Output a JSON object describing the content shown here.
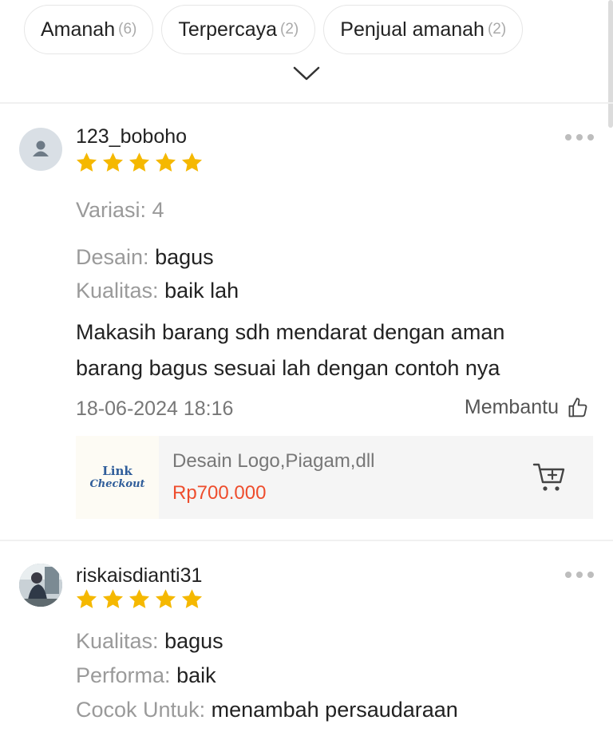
{
  "filters": [
    {
      "label": "Amanah",
      "count": "(6)"
    },
    {
      "label": "Terpercaya",
      "count": "(2)"
    },
    {
      "label": "Penjual amanah",
      "count": "(2)"
    }
  ],
  "icons": {
    "expand": "chevron-down-icon",
    "more": "more-icon",
    "helpful": "thumbs-up-icon",
    "cart": "add-to-cart-icon",
    "avatar_default": "user-icon"
  },
  "colors": {
    "star": "#f5b800",
    "price": "#ee4d2d",
    "label_gray": "#9a9a9a"
  },
  "reviews": [
    {
      "username": "123_boboho",
      "rating": 5,
      "variation": "Variasi: 4",
      "attributes": [
        {
          "label": "Desain:",
          "value": "bagus"
        },
        {
          "label": "Kualitas:",
          "value": "baik lah"
        }
      ],
      "comment_lines": [
        "Makasih barang sdh mendarat dengan aman",
        "barang bagus sesuai lah dengan contoh nya"
      ],
      "date": "18-06-2024 18:16",
      "helpful_label": "Membantu",
      "product": {
        "thumb_line1": "Link",
        "thumb_line2": "Checkout",
        "name": "Desain Logo,Piagam,dll",
        "price": "Rp700.000"
      }
    },
    {
      "username": "riskaisdianti31",
      "rating": 5,
      "attributes": [
        {
          "label": "Kualitas:",
          "value": "bagus"
        },
        {
          "label": "Performa:",
          "value": "baik"
        },
        {
          "label": "Cocok Untuk:",
          "value": "menambah persaudaraan"
        }
      ]
    }
  ]
}
